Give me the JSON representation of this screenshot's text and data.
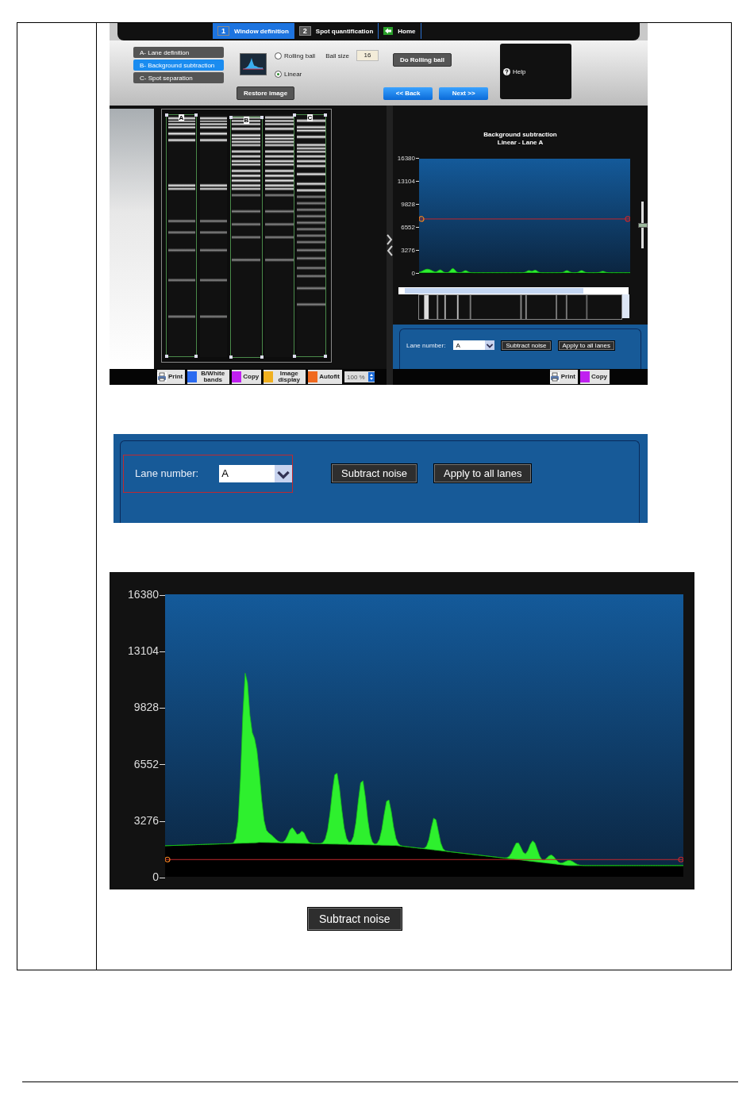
{
  "wizard_tabs": [
    {
      "kind": "step",
      "number": "1",
      "label": "Window definition",
      "selected": true
    },
    {
      "kind": "step",
      "number": "2",
      "label": "Spot quantification",
      "selected": false
    },
    {
      "kind": "home",
      "label": "Home",
      "selected": false
    }
  ],
  "steps": [
    {
      "label": "A- Lane definition",
      "selected": false
    },
    {
      "label": "B- Background subtraction",
      "selected": true
    },
    {
      "label": "C- Spot separation",
      "selected": false
    }
  ],
  "method": {
    "options": [
      {
        "label": "Rolling ball",
        "selected": false
      },
      {
        "label": "Linear",
        "selected": true
      }
    ],
    "ball_size_label": "Ball size",
    "ball_size": "16",
    "run_button": "Do Rolling ball"
  },
  "nav": {
    "restore": "Restore image",
    "back": "<< Back",
    "next": "Next >>"
  },
  "help": "Help",
  "gel": {
    "lanes": [
      "A",
      "B",
      "C"
    ]
  },
  "left_toolbar": [
    {
      "kind": "print",
      "label": "Print"
    },
    {
      "kind": "bands",
      "label": "B/White bands"
    },
    {
      "kind": "copy",
      "label": "Copy"
    },
    {
      "kind": "display",
      "label": "Image display"
    },
    {
      "kind": "autofit",
      "label": "Autofit"
    }
  ],
  "zoom": "100 %",
  "profile": {
    "title": "Background subtraction",
    "subtitle": "Linear - Lane A",
    "y_ticks": [
      "16380",
      "13104",
      "9828",
      "6552",
      "3276",
      "0"
    ],
    "threshold_slider": {
      "level": 0.5
    }
  },
  "lane_panel": {
    "label": "Lane number:",
    "value": "A",
    "buttons": [
      "Subtract noise",
      "Apply to all lanes"
    ]
  },
  "right_toolbar": [
    {
      "kind": "print",
      "label": "Print"
    },
    {
      "kind": "copy",
      "label": "Copy"
    }
  ],
  "zoomed_panel": {
    "label": "Lane number:",
    "value": "A",
    "buttons": [
      "Subtract noise",
      "Apply to all lanes"
    ]
  },
  "zoomed_chart": {
    "y_ticks": [
      "16380",
      "13104",
      "9828",
      "6552",
      "3276",
      "0"
    ]
  },
  "subtract_button": "Subtract noise"
}
